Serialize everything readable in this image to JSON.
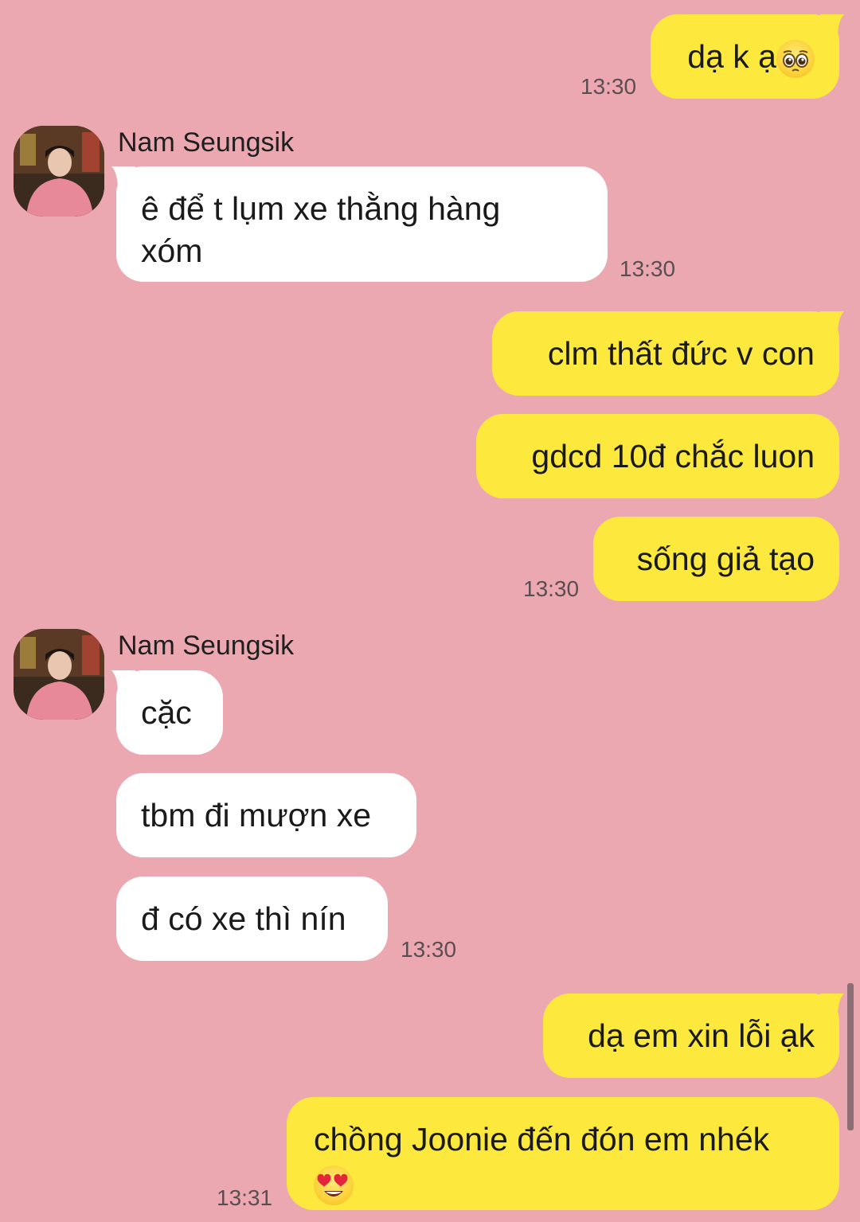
{
  "contact": {
    "name": "Nam Seungsik"
  },
  "messages": {
    "m1": {
      "text": "dạ k ạ",
      "emoji": "pleading-face-emoji",
      "time": "13:30"
    },
    "m2": {
      "sender": "Nam Seungsik",
      "line1": "ê để t lụm xe thằng hàng",
      "line2": "xóm",
      "time": "13:30"
    },
    "m3": {
      "text": "clm thất đức v con"
    },
    "m4": {
      "text": "gdcd 10đ chắc luon"
    },
    "m5": {
      "text": "sống giả tạo",
      "time": "13:30"
    },
    "m6": {
      "sender": "Nam Seungsik",
      "text": "cặc"
    },
    "m7": {
      "text": "tbm đi mượn xe"
    },
    "m8": {
      "text": "đ có xe thì nín",
      "time": "13:30"
    },
    "m9": {
      "text": "dạ em xin lỗi ạk"
    },
    "m10": {
      "line1": "chồng Joonie đến đón em nhék",
      "emoji": "heart-eyes-emoji",
      "time": "13:31"
    }
  },
  "colors": {
    "background": "#eba8b1",
    "outgoing_bubble": "#fde83d",
    "incoming_bubble": "#ffffff"
  }
}
